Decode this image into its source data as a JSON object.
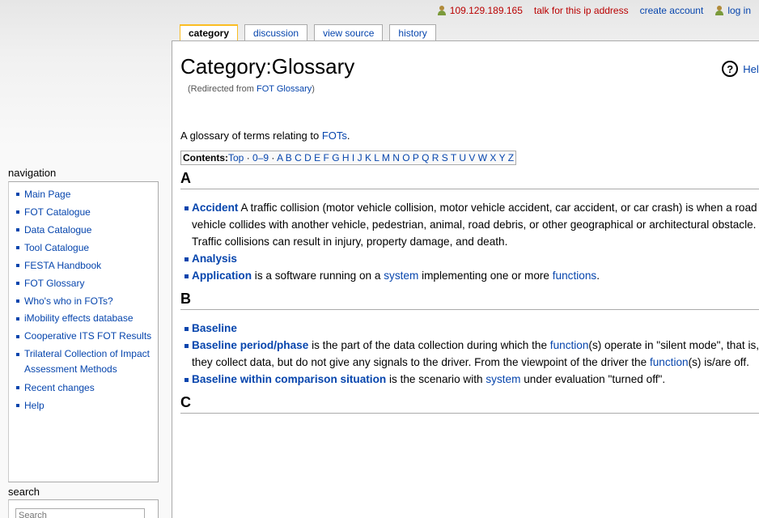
{
  "personal": {
    "ip": "109.129.189.165",
    "talk": "talk for this ip address",
    "create_account": "create account",
    "log_in": "log in"
  },
  "tabs": [
    {
      "label": "category",
      "selected": true
    },
    {
      "label": "discussion",
      "selected": false
    },
    {
      "label": "view source",
      "selected": false
    },
    {
      "label": "history",
      "selected": false
    }
  ],
  "page": {
    "title": "Category:Glossary",
    "help_label": "Help",
    "redirect_prefix": "(Redirected from ",
    "redirect_link": "FOT Glossary",
    "redirect_suffix": ")",
    "intro_prefix": "A glossary of terms relating to ",
    "intro_link": "FOTs",
    "intro_suffix": ".",
    "toc_label": "Contents:",
    "toc_top": "Top",
    "toc_09": "0–9",
    "toc_letters": [
      "A",
      "B",
      "C",
      "D",
      "E",
      "F",
      "G",
      "H",
      "I",
      "J",
      "K",
      "L",
      "M",
      "N",
      "O",
      "P",
      "Q",
      "R",
      "S",
      "T",
      "U",
      "V",
      "W",
      "X",
      "Y",
      "Z"
    ]
  },
  "sections": {
    "a": {
      "heading": "A",
      "accident_term": "Accident",
      "accident_text": " A traffic collision (motor vehicle collision, motor vehicle accident, car accident, or car crash) is when a road vehicle collides with another vehicle, pedestrian, animal, road debris, or other geographical or architectural obstacle. Traffic collisions can result in injury, property damage, and death.",
      "analysis_term": "Analysis",
      "application_term": "Application",
      "application_t1": " is a software running on a ",
      "application_l1": "system",
      "application_t2": " implementing one or more ",
      "application_l2": "functions",
      "application_t3": "."
    },
    "b": {
      "heading": "B",
      "baseline_term": "Baseline",
      "period_term": "Baseline period/phase",
      "period_t1": " is the part of the data collection during which the ",
      "period_l1": "function",
      "period_t2": "(s) operate in \"silent mode\", that is, they collect data, but do not give any signals to the driver. From the viewpoint of the driver the ",
      "period_l2": "function",
      "period_t3": "(s) is/are off.",
      "within_term": "Baseline within comparison situation",
      "within_t1": " is the scenario with ",
      "within_l1": "system",
      "within_t2": " under evaluation \"turned off\"."
    },
    "c_heading": "C"
  },
  "sidebar": {
    "nav_title": "navigation",
    "nav_items": [
      "Main Page",
      "FOT Catalogue",
      "Data Catalogue",
      "Tool Catalogue",
      "FESTA Handbook",
      "FOT Glossary",
      "Who's who in FOTs?",
      "iMobility effects database",
      "Cooperative ITS FOT Results",
      "Trilateral Collection of Impact Assessment Methods",
      "Recent changes",
      "Help"
    ],
    "search_title": "search",
    "search_placeholder": "Search"
  }
}
